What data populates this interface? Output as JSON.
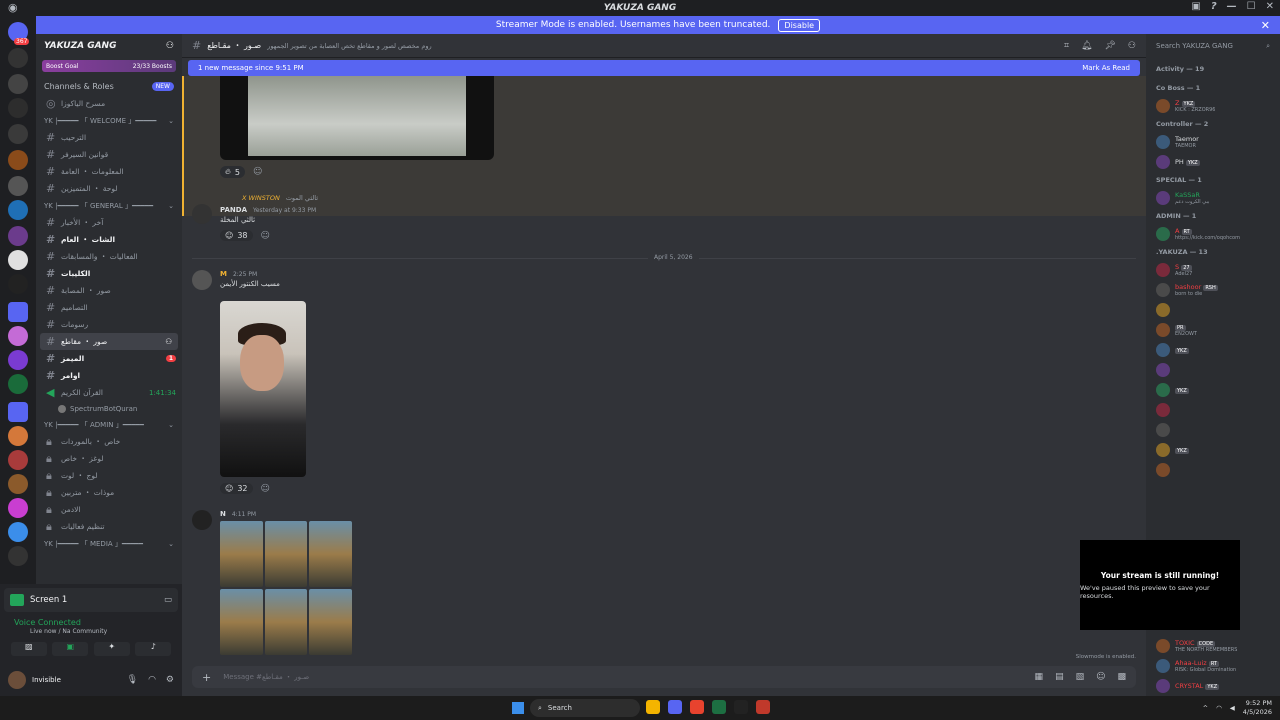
{
  "window": {
    "title": "YAKUZA GANG",
    "rail_badge": "367"
  },
  "streamer": {
    "message": "Streamer Mode is enabled. Usernames have been truncated.",
    "disable_label": "Disable"
  },
  "server": {
    "name": "YAKUZA GANG",
    "boost_goal_label": "Boost Goal",
    "boost_count": "23/33 Boosts",
    "channels_roles": "Channels & Roles",
    "new_badge": "NEW"
  },
  "sidebar": {
    "stage": "مسرح الياكوزا",
    "categories": {
      "welcome": "YK |━━━━━ 「 WELCOME 」━━━━━",
      "general": "YK |━━━━━ 「 GENERAL 」━━━━━",
      "admin": "YK |━━━━━ 「 ADMIN 」━━━━━",
      "media": "YK |━━━━━ 「 MEDIA 」━━━━━"
    },
    "welcome_channels": [
      "الترحيب",
      "قوانين السيرفر",
      "المعلومات ・ العامة",
      "لوحة ・ المتميزين"
    ],
    "general_channels": [
      "آخر ・ الأخبار",
      "الشات ・ العام",
      "الفعاليات ・ والمسابقات",
      "الكليبات",
      "صور ・ المصابة",
      "التصاميم",
      "رسومات",
      "صور ・ مقاطع",
      "الميمز",
      "اوامر"
    ],
    "unread_badge": "1",
    "voice_channel": "القرآن الكريم",
    "voice_time": "1:41:34",
    "voice_user": "SpectrumBotQuran",
    "admin_channels": [
      "خاص ・ بالموردات",
      "لوغز ・ خاص",
      "لوج ・ لوت",
      "موذات ・ متربين",
      "الادمن",
      "تنظيم فعاليات"
    ]
  },
  "voice_panel": {
    "screen_label": "Screen 1",
    "connected": "Voice Connected",
    "sub": "Live now / Na Community",
    "user_status": "Invisible"
  },
  "channel": {
    "name": "صـور ・ مقـاطع",
    "topic": "روم مخصص لصور و مقاطع تخص العصابة من تصوير الجمهور",
    "new_message": "1 new message since 9:51 PM",
    "mark_read": "Mark As Read"
  },
  "messages": {
    "m1_react_count": "5",
    "m2_reply_user": "X WINSTON",
    "m2_reply_text": "ثالثي الموت",
    "m2_user": "PANDA",
    "m2_time": "Yesterday at 9:33 PM",
    "m2_text": "ثالثي المخلة",
    "m2_react_count": "38",
    "date_divider": "April 5, 2026",
    "m3_user": "M",
    "m3_time": "2:25 PM",
    "m3_text": "مسيب الكنتور الأيمن",
    "m3_react_count": "32",
    "m4_user": "N",
    "m4_time": "4:11 PM"
  },
  "composer": {
    "placeholder": "Message #صـور ・ مقـاطع",
    "slowmode": "Slowmode is enabled."
  },
  "members": {
    "search_placeholder": "Search YAKUZA GANG",
    "activity": "Activity — 19",
    "groups": [
      {
        "name": "Co Boss — 1",
        "members": [
          {
            "name": "Z",
            "status": "KICK : ZRZOR96",
            "tag": "YKZ",
            "color": "#f23f43"
          }
        ]
      },
      {
        "name": "Controller — 2",
        "members": [
          {
            "name": "Taemor",
            "status": "TAEMOR",
            "tag": "",
            "color": "#dbdee1"
          },
          {
            "name": "PH",
            "status": "",
            "tag": "YKZ",
            "color": "#dbdee1"
          }
        ]
      },
      {
        "name": "SPECIAL — 1",
        "members": [
          {
            "name": "KaSSaR",
            "status": "يبي الكروت دعم",
            "tag": "",
            "color": "#23a55a"
          }
        ]
      },
      {
        "name": "ADMIN — 1",
        "members": [
          {
            "name": "A",
            "status": "https://kick.com/oqohcom",
            "tag": "RT",
            "color": "#f23f43"
          }
        ]
      },
      {
        "name": ".YAKUZA — 13",
        "members": [
          {
            "name": "S",
            "status": "Adel27",
            "tag": "27",
            "color": "#f23f43"
          },
          {
            "name": "bashoor",
            "status": "born to die",
            "tag": "RSH",
            "color": "#f23f43"
          },
          {
            "name": "",
            "status": "",
            "tag": "",
            "color": "#f23f43"
          },
          {
            "name": "",
            "status": "EN2OWT",
            "tag": "PR",
            "color": "#f23f43"
          },
          {
            "name": "",
            "status": "",
            "tag": "YKZ",
            "color": "#f23f43"
          },
          {
            "name": "",
            "status": "",
            "tag": "",
            "color": "#f23f43"
          },
          {
            "name": "",
            "status": "",
            "tag": "YKZ",
            "color": "#f23f43"
          },
          {
            "name": "",
            "status": "",
            "tag": "",
            "color": "#f23f43"
          },
          {
            "name": "",
            "status": "",
            "tag": "",
            "color": "#f23f43"
          },
          {
            "name": "",
            "status": "",
            "tag": "YKZ",
            "color": "#f23f43"
          },
          {
            "name": "",
            "status": "",
            "tag": "",
            "color": "#f23f43"
          }
        ]
      }
    ],
    "bottom": [
      {
        "name": "TOXIC",
        "status": "THE NORTH REMEMBERS",
        "tag": "CODE",
        "color": "#f23f43"
      },
      {
        "name": "Ahaa-Luiz",
        "status": "RISK: Global Domination",
        "tag": "RT",
        "color": "#f23f43"
      },
      {
        "name": "CRYSTAL",
        "status": "",
        "tag": "YKZ",
        "color": "#f23f43"
      }
    ]
  },
  "toast": {
    "title": "Your stream is still running!",
    "body": "We've paused this preview to save your resources."
  },
  "taskbar": {
    "search": "Search",
    "time": "9:52 PM",
    "date": "4/5/2026"
  }
}
